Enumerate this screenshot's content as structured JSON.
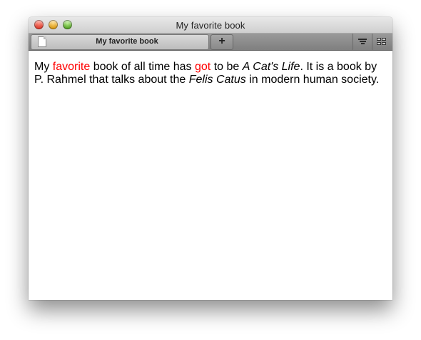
{
  "window": {
    "title": "My favorite book"
  },
  "tabs": [
    {
      "label": "My favorite book",
      "icon": "page-icon",
      "active": true
    }
  ],
  "toolbar": {
    "new_tab_label": "+",
    "buttons": [
      {
        "icon": "list-icon"
      },
      {
        "icon": "grid-icon"
      }
    ]
  },
  "document": {
    "colors": {
      "highlight": "#ff0000",
      "text": "#000000"
    },
    "paragraph": [
      {
        "text": "My ",
        "style": "normal"
      },
      {
        "text": "favorite",
        "style": "red"
      },
      {
        "text": " book of all time has ",
        "style": "normal"
      },
      {
        "text": "got",
        "style": "red"
      },
      {
        "text": " to be ",
        "style": "normal"
      },
      {
        "text": "A Cat's Life",
        "style": "italic"
      },
      {
        "text": ". It is a book by P. Rahmel that talks about the ",
        "style": "normal"
      },
      {
        "text": "Felis Catus",
        "style": "italic"
      },
      {
        "text": " in modern human society.",
        "style": "normal"
      }
    ]
  }
}
